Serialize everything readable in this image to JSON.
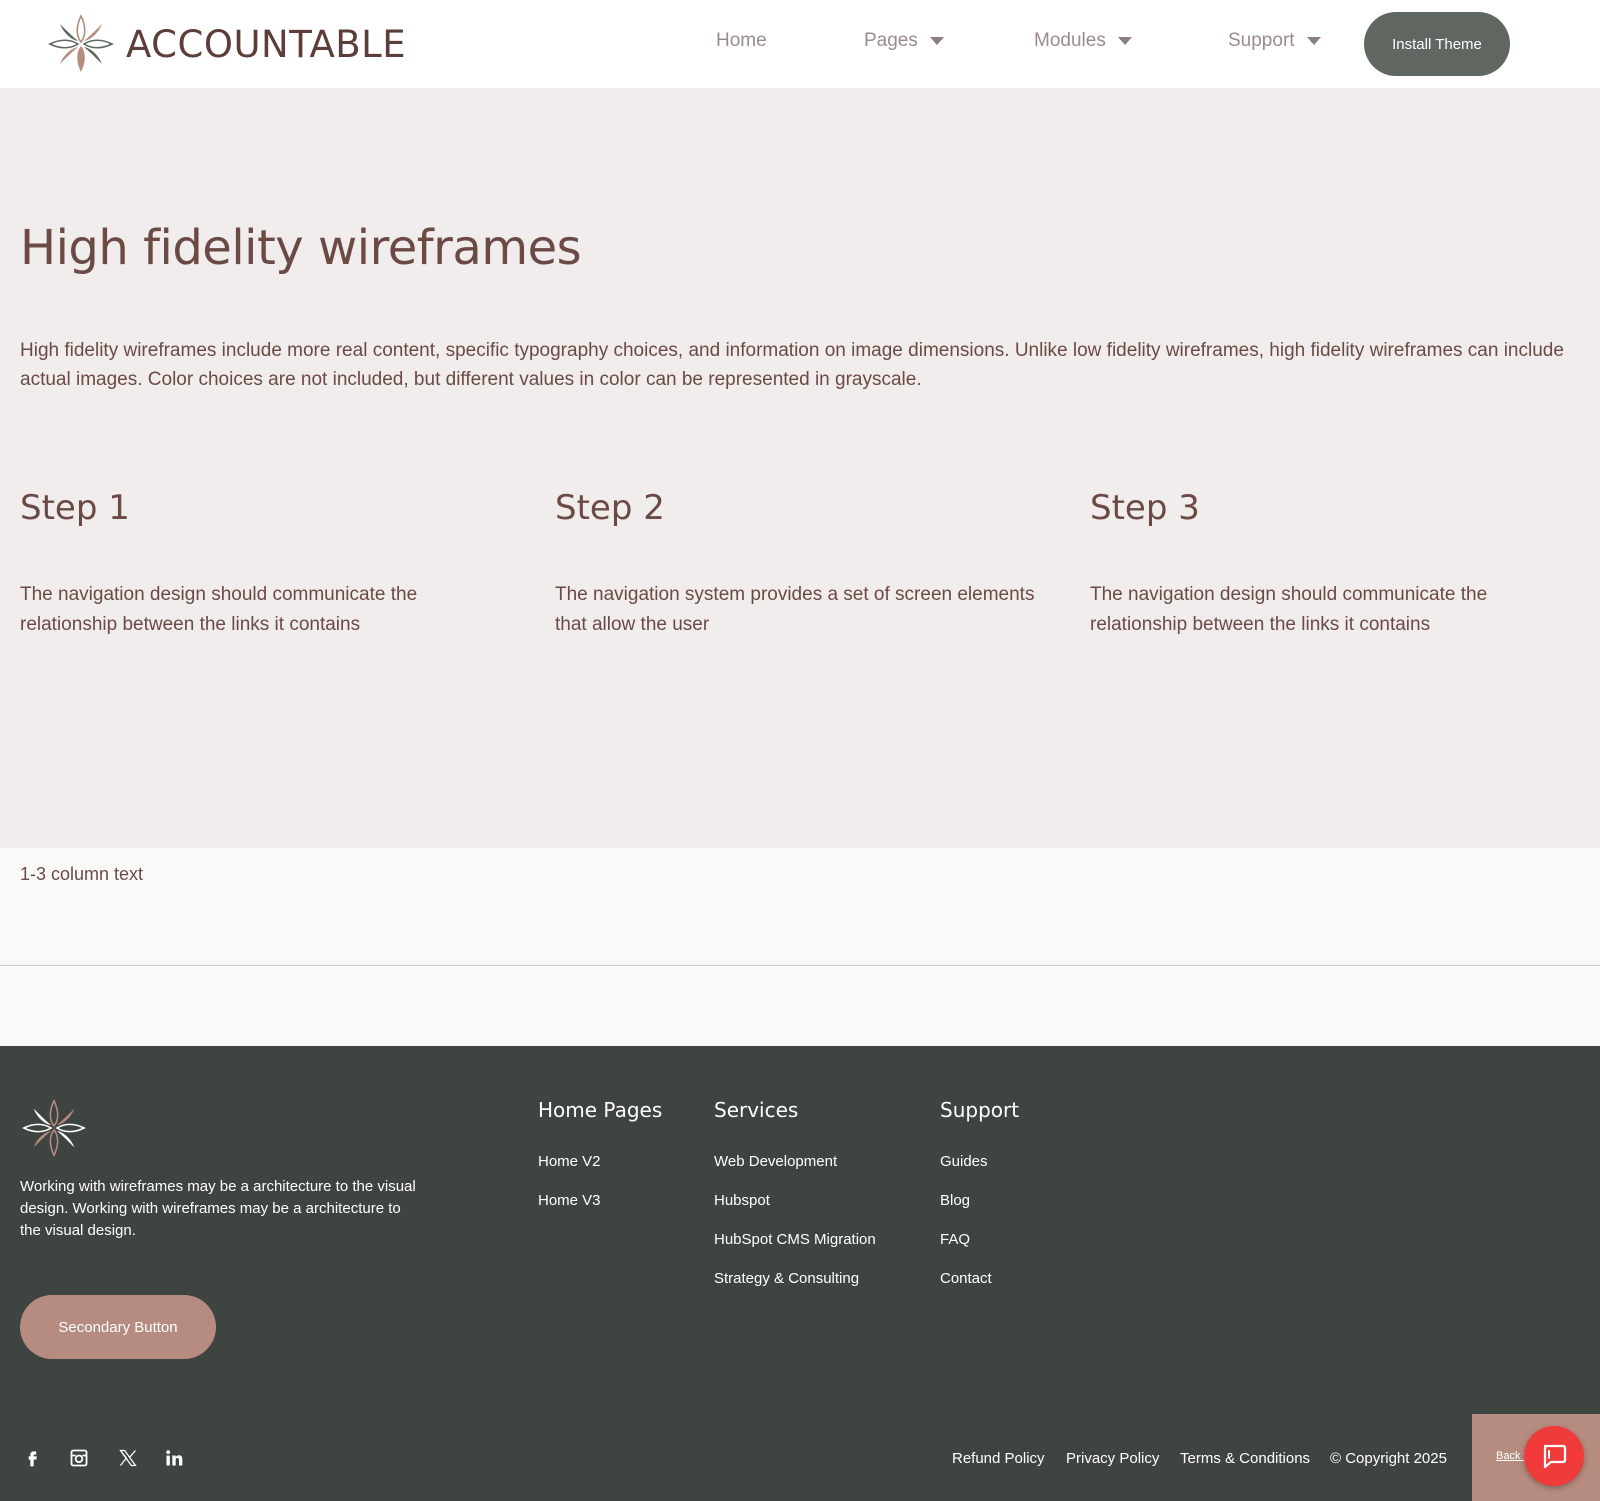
{
  "header": {
    "brand": "ACCOUNTABLE",
    "nav": [
      {
        "label": "Home",
        "dropdown": false
      },
      {
        "label": "Pages",
        "dropdown": true
      },
      {
        "label": "Modules",
        "dropdown": true
      },
      {
        "label": "Support",
        "dropdown": true
      }
    ],
    "cta_label": "Install Theme"
  },
  "hero": {
    "title": "High fidelity wireframes",
    "description": "High fidelity wireframes include more real content, specific typography choices, and information on image dimensions. Unlike low fidelity wireframes, high fidelity wireframes can include actual images. Color choices are not included, but different values in color can be represented in grayscale.",
    "steps": [
      {
        "title": "Step 1",
        "text": "The navigation design should communicate the relationship between the links it contains"
      },
      {
        "title": "Step 2",
        "text": "The navigation system provides a set of screen elements that allow the user"
      },
      {
        "title": "Step 3",
        "text": "The navigation design should communicate the relationship between the links it contains"
      }
    ]
  },
  "column_text": "1-3 column text",
  "footer": {
    "description": "Working with wireframes may be a architecture to the visual design. Working with wireframes may be a architecture to the visual design.",
    "secondary_button": "Secondary Button",
    "columns": [
      {
        "title": "Home Pages",
        "links": [
          "Home V2",
          "Home V3"
        ]
      },
      {
        "title": "Services",
        "links": [
          "Web Development",
          "Hubspot",
          "HubSpot CMS Migration",
          "Strategy & Consulting"
        ]
      },
      {
        "title": "Support",
        "links": [
          "Guides",
          "Blog",
          "FAQ",
          "Contact"
        ]
      }
    ],
    "social_icons": [
      "facebook-icon",
      "instagram-icon",
      "x-icon",
      "linkedin-icon"
    ],
    "legal_links": [
      "Refund Policy",
      "Privacy Policy",
      "Terms & Conditions"
    ],
    "copyright": "© Copyright 2025",
    "back_to_top": "Back to top"
  },
  "colors": {
    "brand_text": "#5d3d38",
    "hero_bg": "#f1edec",
    "footer_bg": "#3e4440",
    "accent": "#b68c80",
    "install_button": "#5f6760",
    "chat_button": "#f13a3a"
  }
}
